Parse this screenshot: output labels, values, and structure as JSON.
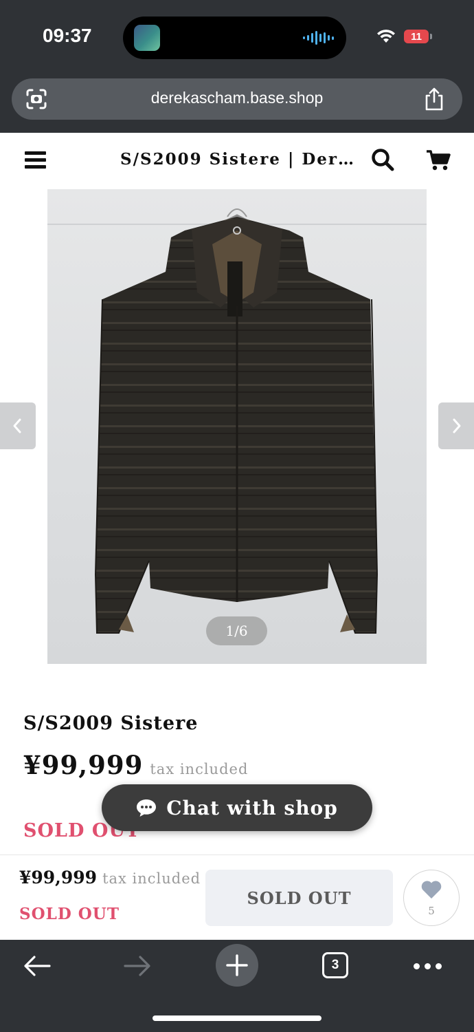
{
  "status_bar": {
    "time": "09:37",
    "battery": "11"
  },
  "browser": {
    "url": "derekascham.base.shop",
    "tab_count": "3"
  },
  "header": {
    "title": "S/S2009 Sistere | Derek Ascham"
  },
  "gallery": {
    "counter": "1/6"
  },
  "product": {
    "name": "S/S2009 Sistere",
    "price": "¥99,999",
    "tax_note": "tax included",
    "status": "SOLD OUT"
  },
  "chat": {
    "label": "Chat with shop"
  },
  "buy_bar": {
    "price": "¥99,999",
    "tax_note": "tax included",
    "status": "SOLD OUT",
    "button_label": "SOLD OUT",
    "favorite_count": "5"
  },
  "colors": {
    "browser_chrome": "#2f3236",
    "sold_out": "#e0506f",
    "chat_button": "#3c3c3c",
    "buy_button_bg": "#eef0f4"
  },
  "icons": [
    "scan-icon",
    "share-icon",
    "menu-icon",
    "search-icon",
    "cart-icon",
    "chevron-left-icon",
    "chevron-right-icon",
    "chat-bubble-icon",
    "heart-icon",
    "back-arrow-icon",
    "forward-arrow-icon",
    "plus-icon",
    "tabs-icon",
    "more-icon"
  ]
}
